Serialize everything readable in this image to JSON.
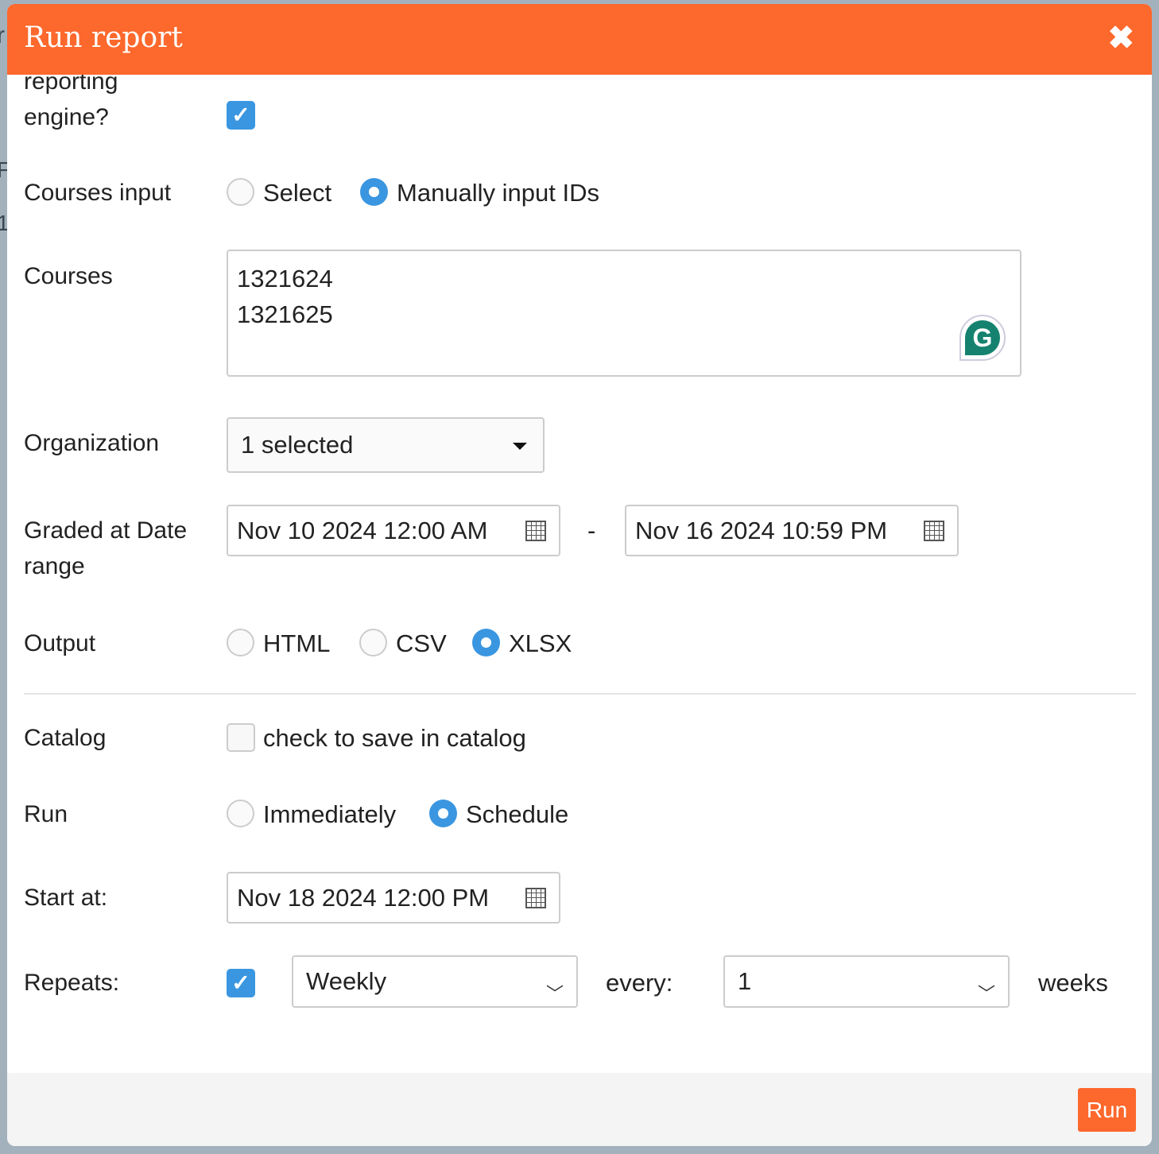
{
  "window": {
    "title": "Run report",
    "close_icon": "times-icon"
  },
  "fields": {
    "engine": {
      "label": "reporting engine?",
      "checked": true
    },
    "courses_input": {
      "label": "Courses input",
      "options": [
        "Select",
        "Manually input IDs"
      ],
      "selected": "Manually input IDs"
    },
    "courses": {
      "label": "Courses",
      "lines": [
        "1321624",
        "1321625"
      ]
    },
    "organization": {
      "label": "Organization",
      "value": "1 selected"
    },
    "graded_range": {
      "label": "Graded at Date range",
      "start": "Nov 10 2024 12:00 AM",
      "separator": "-",
      "end": "Nov 16 2024 10:59 PM"
    },
    "output": {
      "label": "Output",
      "options": [
        "HTML",
        "CSV",
        "XLSX"
      ],
      "selected": "XLSX"
    },
    "catalog": {
      "label": "Catalog",
      "checkbox_label": "check to save in catalog",
      "checked": false
    },
    "run": {
      "label": "Run",
      "options": [
        "Immediately",
        "Schedule"
      ],
      "selected": "Schedule"
    },
    "start_at": {
      "label": "Start at:",
      "value": "Nov 18 2024 12:00 PM"
    },
    "repeats": {
      "label": "Repeats:",
      "checked": true,
      "frequency": "Weekly",
      "every_label": "every:",
      "every_value": "1",
      "unit": "weeks"
    }
  },
  "footer": {
    "run_label": "Run"
  },
  "colors": {
    "accent": "#fd682c",
    "blue": "#3a96e0"
  }
}
